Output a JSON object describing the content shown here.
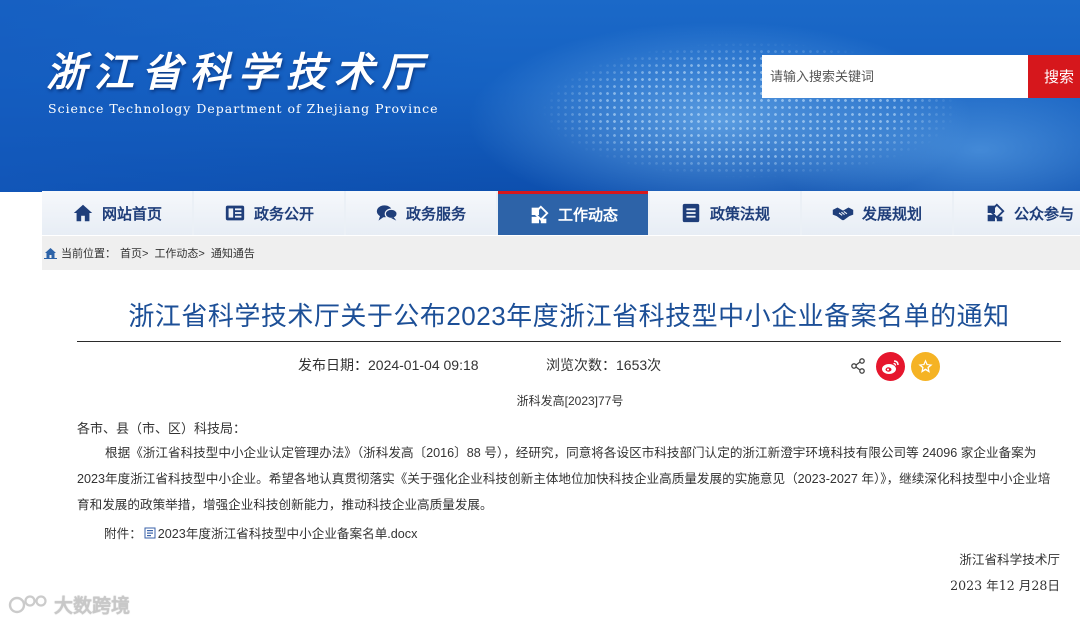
{
  "header": {
    "site_title": "浙江省科学技术厅",
    "site_subtitle": "Science Technology Department of Zhejiang Province",
    "search_placeholder": "请输入搜索关键词",
    "search_button": "搜索"
  },
  "nav": {
    "items": [
      {
        "label": "网站首页",
        "icon": "home-icon"
      },
      {
        "label": "政务公开",
        "icon": "newspaper-icon"
      },
      {
        "label": "政务服务",
        "icon": "chat-icon"
      },
      {
        "label": "工作动态",
        "icon": "work-icon",
        "active": true
      },
      {
        "label": "政策法规",
        "icon": "list-icon"
      },
      {
        "label": "发展规划",
        "icon": "handshake-icon"
      },
      {
        "label": "公众参与",
        "icon": "participate-icon"
      }
    ]
  },
  "breadcrumb": {
    "prefix": "当前位置：",
    "items": [
      "首页>",
      "工作动态>",
      "通知通告"
    ]
  },
  "article": {
    "title": "浙江省科学技术厅关于公布2023年度浙江省科技型中小企业备案名单的通知",
    "publish_date": "发布日期：2024-01-04 09:18",
    "views": "浏览次数：1653次",
    "doc_number": "浙科发高[2023]77号",
    "recipient": "各市、县（市、区）科技局：",
    "body": "根据《浙江省科技型中小企业认定管理办法》（浙科发高〔2016〕88 号），经研究，同意将各设区市科技部门认定的浙江新澄宇环境科技有限公司等 24096 家企业备案为2023年度浙江省科技型中小企业。希望各地认真贯彻落实《关于强化企业科技创新主体地位加快科技企业高质量发展的实施意见（2023-2027 年）》，继续深化科技型中小企业培育和发展的政策举措，增强企业科技创新能力，推动科技企业高质量发展。",
    "attachment_label": "附件：",
    "attachment_file": "2023年度浙江省科技型中小企业备案名单.docx",
    "sign_org": "浙江省科学技术厅",
    "sign_date": "2023 年12 月28日"
  },
  "watermark": "大数跨境",
  "colors": {
    "banner_blue": "#1561c2",
    "nav_text": "#1f3e7a",
    "nav_active": "#2d63a8",
    "title_blue": "#1c4f97",
    "accent_red": "#d6171c",
    "weibo_red": "#e6162d",
    "favorite_yellow": "#f5b324"
  }
}
